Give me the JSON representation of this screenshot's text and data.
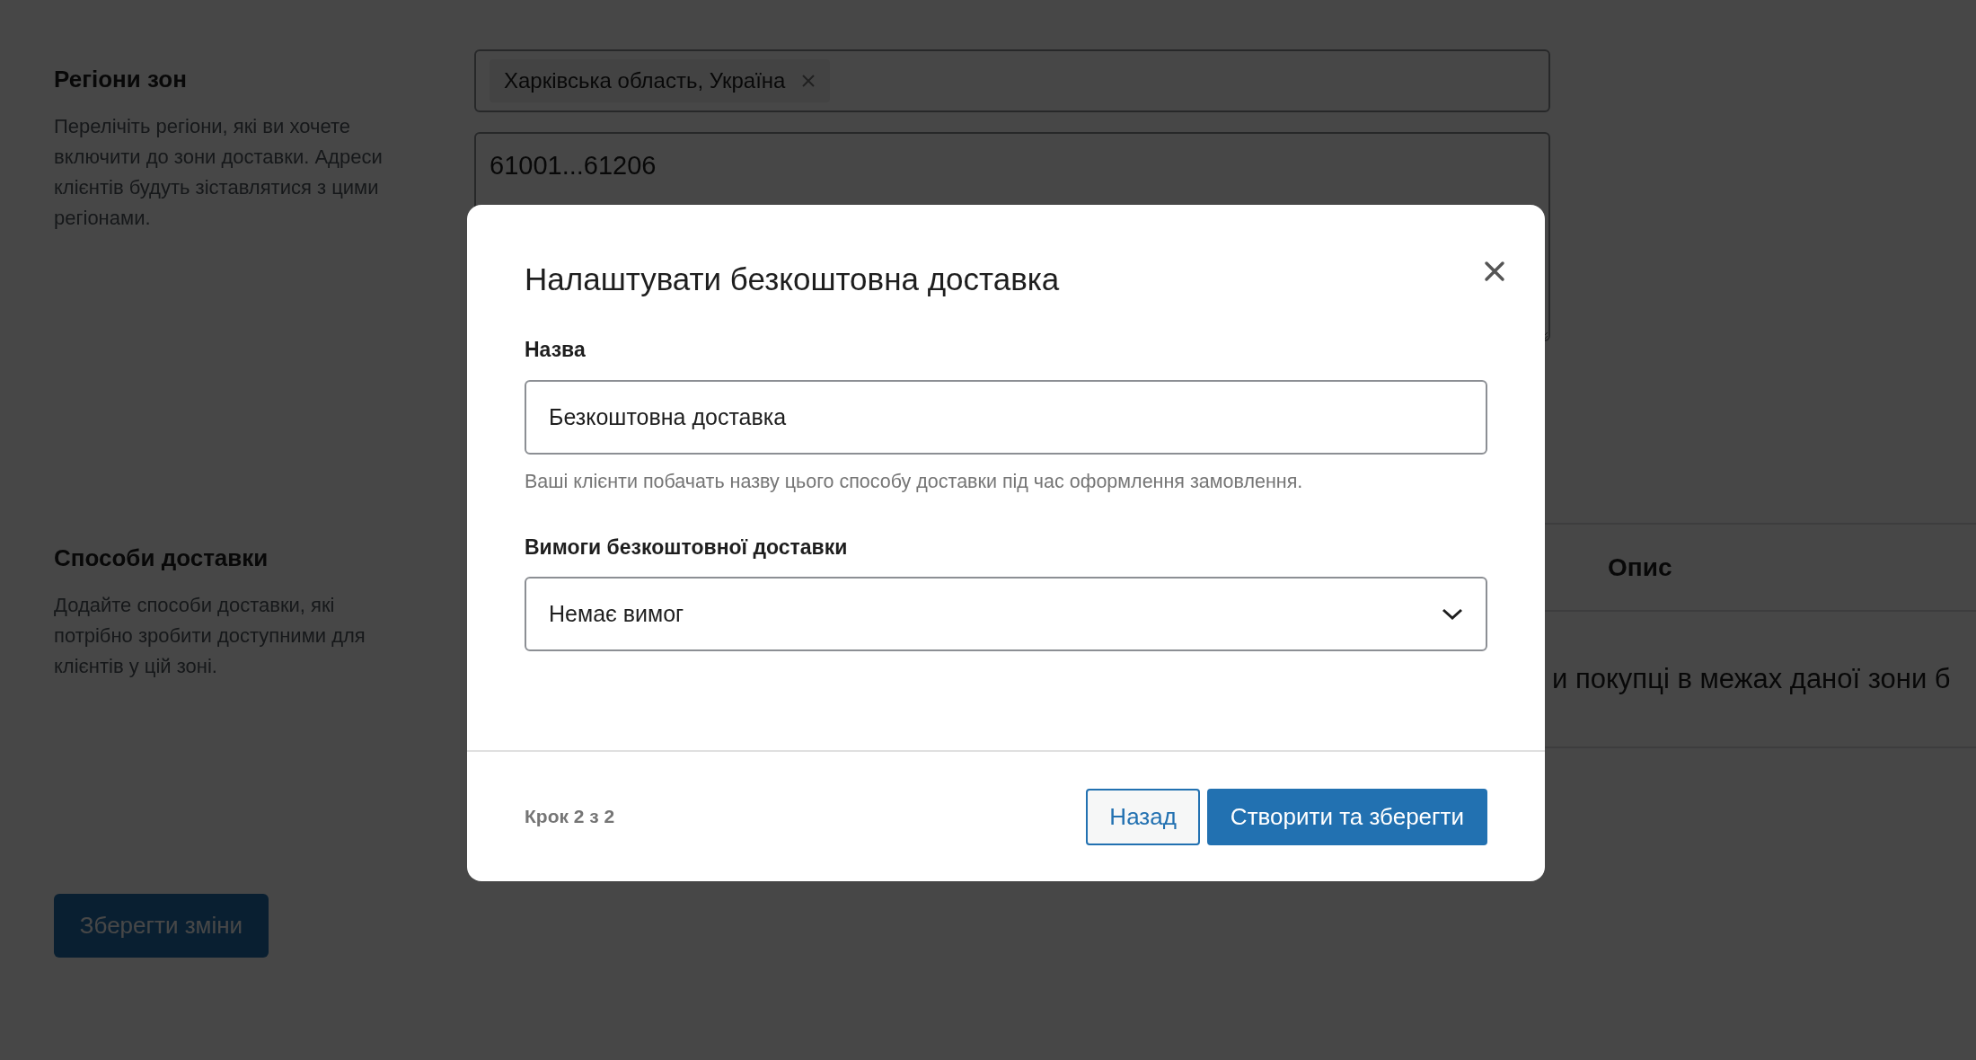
{
  "zone_regions": {
    "title": "Регіони зон",
    "description": "Перелічіть регіони, які ви хочете включити до зони доставки. Адреси клієнтів будуть зіставлятися з цими регіонами.",
    "tags": [
      {
        "label": "Харківська область, Україна"
      }
    ],
    "postcodes": "61001...61206"
  },
  "shipping_methods": {
    "title": "Способи доставки",
    "description": "Додайте способи доставки, які потрібно зробити доступними для клієнтів у цій зоні.",
    "table": {
      "columns": [
        "Опис"
      ],
      "rows": [
        {
          "cells": [
            "и покупці в межах даної зони б"
          ]
        }
      ]
    }
  },
  "save_button": "Зберегти зміни",
  "modal": {
    "title": "Налаштувати безкоштовна доставка",
    "fields": [
      {
        "kind": "text",
        "label": "Назва",
        "value": "Безкоштовна доставка",
        "help": "Ваші клієнти побачать назву цього способу доставки під час оформлення замовлення."
      },
      {
        "kind": "select",
        "label": "Вимоги безкоштовної доставки",
        "value": "Немає вимог"
      }
    ],
    "step": "Крок 2 з 2",
    "buttons": [
      {
        "label": "Назад",
        "kind": "secondary"
      },
      {
        "label": "Створити та зберегти",
        "kind": "primary"
      }
    ]
  }
}
